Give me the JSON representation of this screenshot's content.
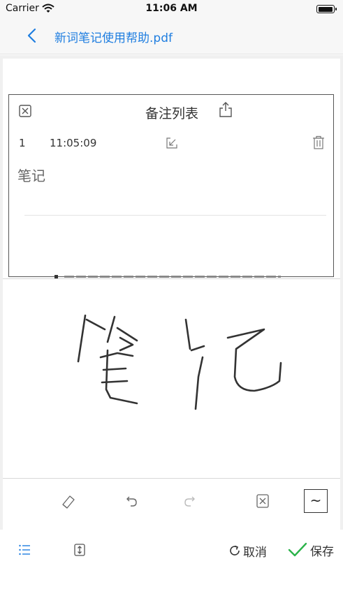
{
  "status_bar": {
    "carrier": "Carrier",
    "time": "11:06 AM",
    "battery_level": 1.0
  },
  "nav": {
    "title": "新词笔记使用帮助.pdf",
    "accent_color": "#1f7ee0"
  },
  "notes_panel": {
    "title": "备注列表",
    "notes": [
      {
        "index": "1",
        "time": "11:05:09",
        "text": "笔记"
      }
    ]
  },
  "draw_toolbar": {
    "stroke_label": "~"
  },
  "bottom_bar": {
    "cancel_label": "取消",
    "save_label": "保存",
    "save_check_color": "#2bb34a"
  }
}
